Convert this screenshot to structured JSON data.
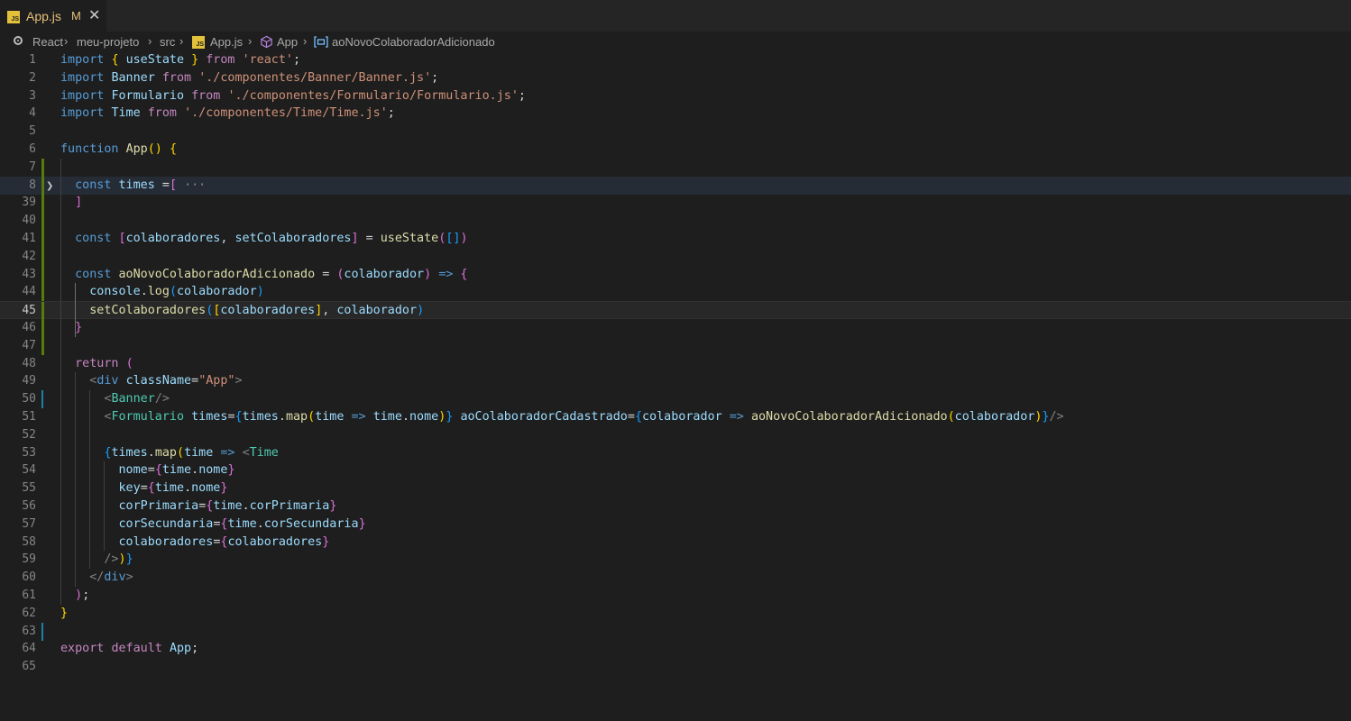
{
  "tab": {
    "label": "App.js",
    "modified": "M",
    "close": "✕",
    "badge": "JS"
  },
  "breadcrumb": {
    "items": [
      "React",
      "meu-projeto",
      "src",
      "App.js",
      "App",
      "aoNovoColaboradorAdicionado"
    ],
    "separator": "›"
  },
  "code": {
    "active_line": 45,
    "lines": [
      {
        "n": "1",
        "t": [
          [
            "kw",
            "import"
          ],
          [
            "pl",
            " "
          ],
          [
            "p1",
            "{"
          ],
          [
            "pl",
            " "
          ],
          [
            "var",
            "useState"
          ],
          [
            "pl",
            " "
          ],
          [
            "p1",
            "}"
          ],
          [
            "pl",
            " "
          ],
          [
            "kc",
            "from"
          ],
          [
            "pl",
            " "
          ],
          [
            "str",
            "'react'"
          ],
          [
            "pl",
            ";"
          ]
        ]
      },
      {
        "n": "2",
        "t": [
          [
            "kw",
            "import"
          ],
          [
            "pl",
            " "
          ],
          [
            "var",
            "Banner"
          ],
          [
            "pl",
            " "
          ],
          [
            "kc",
            "from"
          ],
          [
            "pl",
            " "
          ],
          [
            "str",
            "'./componentes/Banner/Banner.js'"
          ],
          [
            "pl",
            ";"
          ]
        ]
      },
      {
        "n": "3",
        "t": [
          [
            "kw",
            "import"
          ],
          [
            "pl",
            " "
          ],
          [
            "var",
            "Formulario"
          ],
          [
            "pl",
            " "
          ],
          [
            "kc",
            "from"
          ],
          [
            "pl",
            " "
          ],
          [
            "str",
            "'./componentes/Formulario/Formulario.js'"
          ],
          [
            "pl",
            ";"
          ]
        ]
      },
      {
        "n": "4",
        "t": [
          [
            "kw",
            "import"
          ],
          [
            "pl",
            " "
          ],
          [
            "var",
            "Time"
          ],
          [
            "pl",
            " "
          ],
          [
            "kc",
            "from"
          ],
          [
            "pl",
            " "
          ],
          [
            "str",
            "'./componentes/Time/Time.js'"
          ],
          [
            "pl",
            ";"
          ]
        ]
      },
      {
        "n": "5",
        "t": []
      },
      {
        "n": "6",
        "t": [
          [
            "kw",
            "function"
          ],
          [
            "pl",
            " "
          ],
          [
            "fn",
            "App"
          ],
          [
            "p1",
            "()"
          ],
          [
            "pl",
            " "
          ],
          [
            "p1",
            "{"
          ]
        ]
      },
      {
        "n": "7",
        "t": []
      },
      {
        "n": "8",
        "t": [
          [
            "pl",
            "  "
          ],
          [
            "kw",
            "const"
          ],
          [
            "pl",
            " "
          ],
          [
            "var",
            "times"
          ],
          [
            "pl",
            " ="
          ],
          [
            "p2",
            "["
          ],
          [
            "pl",
            " "
          ],
          [
            "ell",
            "···"
          ]
        ]
      },
      {
        "n": "39",
        "t": [
          [
            "pl",
            "  "
          ],
          [
            "p2",
            "]"
          ]
        ]
      },
      {
        "n": "40",
        "t": []
      },
      {
        "n": "41",
        "t": [
          [
            "pl",
            "  "
          ],
          [
            "kw",
            "const"
          ],
          [
            "pl",
            " "
          ],
          [
            "p2",
            "["
          ],
          [
            "var",
            "colaboradores"
          ],
          [
            "pl",
            ", "
          ],
          [
            "var",
            "setColaboradores"
          ],
          [
            "p2",
            "]"
          ],
          [
            "pl",
            " = "
          ],
          [
            "fn",
            "useState"
          ],
          [
            "p2",
            "("
          ],
          [
            "p3",
            "[]"
          ],
          [
            "p2",
            ")"
          ]
        ]
      },
      {
        "n": "42",
        "t": []
      },
      {
        "n": "43",
        "t": [
          [
            "pl",
            "  "
          ],
          [
            "kw",
            "const"
          ],
          [
            "pl",
            " "
          ],
          [
            "fn",
            "aoNovoColaboradorAdicionado"
          ],
          [
            "pl",
            " = "
          ],
          [
            "p2",
            "("
          ],
          [
            "var",
            "colaborador"
          ],
          [
            "p2",
            ")"
          ],
          [
            "pl",
            " "
          ],
          [
            "kw",
            "=>"
          ],
          [
            "pl",
            " "
          ],
          [
            "p2",
            "{"
          ]
        ]
      },
      {
        "n": "44",
        "t": [
          [
            "pl",
            "    "
          ],
          [
            "var",
            "console"
          ],
          [
            "pl",
            "."
          ],
          [
            "fn",
            "log"
          ],
          [
            "p3",
            "("
          ],
          [
            "var",
            "colaborador"
          ],
          [
            "p3",
            ")"
          ]
        ]
      },
      {
        "n": "45",
        "t": [
          [
            "pl",
            "    "
          ],
          [
            "fn",
            "setColaboradores"
          ],
          [
            "p3",
            "("
          ],
          [
            "p1",
            "["
          ],
          [
            "var",
            "colaboradores"
          ],
          [
            "p1",
            "]"
          ],
          [
            "pl",
            ", "
          ],
          [
            "var",
            "colaborador"
          ],
          [
            "p3",
            ")"
          ]
        ]
      },
      {
        "n": "46",
        "t": [
          [
            "pl",
            "  "
          ],
          [
            "p2",
            "}"
          ]
        ]
      },
      {
        "n": "47",
        "t": []
      },
      {
        "n": "48",
        "t": [
          [
            "pl",
            "  "
          ],
          [
            "kc",
            "return"
          ],
          [
            "pl",
            " "
          ],
          [
            "p2",
            "("
          ]
        ]
      },
      {
        "n": "49",
        "t": [
          [
            "pl",
            "    "
          ],
          [
            "tag",
            "<"
          ],
          [
            "kw",
            "div"
          ],
          [
            "pl",
            " "
          ],
          [
            "at",
            "className"
          ],
          [
            "pl",
            "="
          ],
          [
            "str",
            "\"App\""
          ],
          [
            "tag",
            ">"
          ]
        ]
      },
      {
        "n": "50",
        "t": [
          [
            "pl",
            "      "
          ],
          [
            "tag",
            "<"
          ],
          [
            "tg",
            "Banner"
          ],
          [
            "tag",
            "/>"
          ]
        ]
      },
      {
        "n": "51",
        "t": [
          [
            "pl",
            "      "
          ],
          [
            "tag",
            "<"
          ],
          [
            "tg",
            "Formulario"
          ],
          [
            "pl",
            " "
          ],
          [
            "at",
            "times"
          ],
          [
            "pl",
            "="
          ],
          [
            "p3",
            "{"
          ],
          [
            "var",
            "times"
          ],
          [
            "pl",
            "."
          ],
          [
            "fn",
            "map"
          ],
          [
            "p1",
            "("
          ],
          [
            "var",
            "time"
          ],
          [
            "pl",
            " "
          ],
          [
            "kw",
            "=>"
          ],
          [
            "pl",
            " "
          ],
          [
            "var",
            "time"
          ],
          [
            "pl",
            "."
          ],
          [
            "var",
            "nome"
          ],
          [
            "p1",
            ")"
          ],
          [
            "p3",
            "}"
          ],
          [
            "pl",
            " "
          ],
          [
            "at",
            "aoColaboradorCadastrado"
          ],
          [
            "pl",
            "="
          ],
          [
            "p3",
            "{"
          ],
          [
            "var",
            "colaborador"
          ],
          [
            "pl",
            " "
          ],
          [
            "kw",
            "=>"
          ],
          [
            "pl",
            " "
          ],
          [
            "fn",
            "aoNovoColaboradorAdicionado"
          ],
          [
            "p1",
            "("
          ],
          [
            "var",
            "colaborador"
          ],
          [
            "p1",
            ")"
          ],
          [
            "p3",
            "}"
          ],
          [
            "tag",
            "/>"
          ]
        ]
      },
      {
        "n": "52",
        "t": []
      },
      {
        "n": "53",
        "t": [
          [
            "pl",
            "      "
          ],
          [
            "p3",
            "{"
          ],
          [
            "var",
            "times"
          ],
          [
            "pl",
            "."
          ],
          [
            "fn",
            "map"
          ],
          [
            "p1",
            "("
          ],
          [
            "var",
            "time"
          ],
          [
            "pl",
            " "
          ],
          [
            "kw",
            "=>"
          ],
          [
            "pl",
            " "
          ],
          [
            "tag",
            "<"
          ],
          [
            "tg",
            "Time"
          ]
        ]
      },
      {
        "n": "54",
        "t": [
          [
            "pl",
            "        "
          ],
          [
            "at",
            "nome"
          ],
          [
            "pl",
            "="
          ],
          [
            "p2",
            "{"
          ],
          [
            "var",
            "time"
          ],
          [
            "pl",
            "."
          ],
          [
            "var",
            "nome"
          ],
          [
            "p2",
            "}"
          ]
        ]
      },
      {
        "n": "55",
        "t": [
          [
            "pl",
            "        "
          ],
          [
            "at",
            "key"
          ],
          [
            "pl",
            "="
          ],
          [
            "p2",
            "{"
          ],
          [
            "var",
            "time"
          ],
          [
            "pl",
            "."
          ],
          [
            "var",
            "nome"
          ],
          [
            "p2",
            "}"
          ]
        ]
      },
      {
        "n": "56",
        "t": [
          [
            "pl",
            "        "
          ],
          [
            "at",
            "corPrimaria"
          ],
          [
            "pl",
            "="
          ],
          [
            "p2",
            "{"
          ],
          [
            "var",
            "time"
          ],
          [
            "pl",
            "."
          ],
          [
            "var",
            "corPrimaria"
          ],
          [
            "p2",
            "}"
          ]
        ]
      },
      {
        "n": "57",
        "t": [
          [
            "pl",
            "        "
          ],
          [
            "at",
            "corSecundaria"
          ],
          [
            "pl",
            "="
          ],
          [
            "p2",
            "{"
          ],
          [
            "var",
            "time"
          ],
          [
            "pl",
            "."
          ],
          [
            "var",
            "corSecundaria"
          ],
          [
            "p2",
            "}"
          ]
        ]
      },
      {
        "n": "58",
        "t": [
          [
            "pl",
            "        "
          ],
          [
            "at",
            "colaboradores"
          ],
          [
            "pl",
            "="
          ],
          [
            "p2",
            "{"
          ],
          [
            "var",
            "colaboradores"
          ],
          [
            "p2",
            "}"
          ]
        ]
      },
      {
        "n": "59",
        "t": [
          [
            "pl",
            "      "
          ],
          [
            "tag",
            "/>"
          ],
          [
            "p1",
            ")"
          ],
          [
            "p3",
            "}"
          ]
        ]
      },
      {
        "n": "60",
        "t": [
          [
            "pl",
            "    "
          ],
          [
            "tag",
            "</"
          ],
          [
            "kw",
            "div"
          ],
          [
            "tag",
            ">"
          ]
        ]
      },
      {
        "n": "61",
        "t": [
          [
            "pl",
            "  "
          ],
          [
            "p2",
            ")"
          ],
          [
            "pl",
            ";"
          ]
        ]
      },
      {
        "n": "62",
        "t": [
          [
            "p1",
            "}"
          ]
        ]
      },
      {
        "n": "63",
        "t": []
      },
      {
        "n": "64",
        "t": [
          [
            "kc",
            "export"
          ],
          [
            "pl",
            " "
          ],
          [
            "kc",
            "default"
          ],
          [
            "pl",
            " "
          ],
          [
            "var",
            "App"
          ],
          [
            "pl",
            ";"
          ]
        ]
      },
      {
        "n": "65",
        "t": []
      }
    ]
  }
}
